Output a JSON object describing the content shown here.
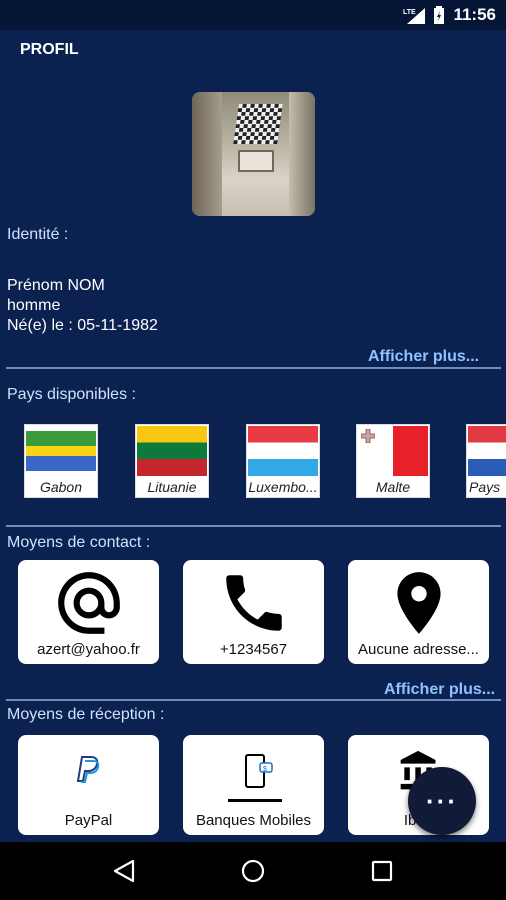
{
  "status_bar": {
    "time": "11:56",
    "network_icon": "lte-signal-icon",
    "battery_icon": "battery-icon"
  },
  "app_bar": {
    "title": "PROFIL"
  },
  "identity": {
    "section_label": "Identité :",
    "name": "Prénom NOM",
    "gender": "homme",
    "birth": "Né(e) le : 05-11-1982",
    "more_label": "Afficher plus..."
  },
  "countries": {
    "section_label": "Pays disponibles :",
    "items": [
      {
        "name": "Gabon"
      },
      {
        "name": "Lituanie"
      },
      {
        "name": "Luxembo..."
      },
      {
        "name": "Malte"
      },
      {
        "name": "Pays"
      }
    ]
  },
  "contact": {
    "section_label": "Moyens de contact :",
    "items": [
      {
        "label": "azert@yahoo.fr",
        "icon": "at-icon"
      },
      {
        "label": "+1234567",
        "icon": "phone-icon"
      },
      {
        "label": "Aucune adresse...",
        "icon": "location-pin-icon"
      }
    ],
    "more_label": "Afficher plus..."
  },
  "reception": {
    "section_label": "Moyens de réception :",
    "items": [
      {
        "label": "PayPal",
        "icon": "paypal-icon"
      },
      {
        "label": "Banques Mobiles",
        "icon": "mobile-bank-icon"
      },
      {
        "label": "Iban",
        "icon": "bank-icon"
      }
    ]
  },
  "fab": {
    "label": "···"
  },
  "nav": {
    "back": "back-icon",
    "home": "home-icon",
    "recents": "recents-icon"
  }
}
